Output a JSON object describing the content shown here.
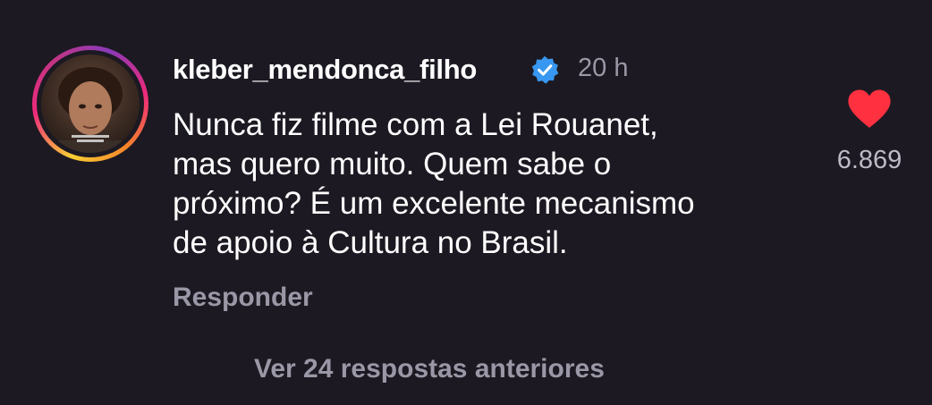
{
  "comment": {
    "username": "kleber_mendonca_filho",
    "verified": true,
    "time": "20 h",
    "text_lines": [
      "Nunca fiz filme com a Lei Rouanet,",
      "mas quero muito. Quem sabe o",
      "próximo? É um excelente mecanismo",
      "de apoio à Cultura no Brasil."
    ],
    "reply_label": "Responder",
    "like_count": "6.869",
    "liked": true
  },
  "thread": {
    "view_replies_label": "Ver 24 respostas anteriores"
  },
  "colors": {
    "background": "#1c1922",
    "muted_text": "#9a97a6",
    "heart": "#ff3040",
    "verified_badge": "#3897f0"
  }
}
